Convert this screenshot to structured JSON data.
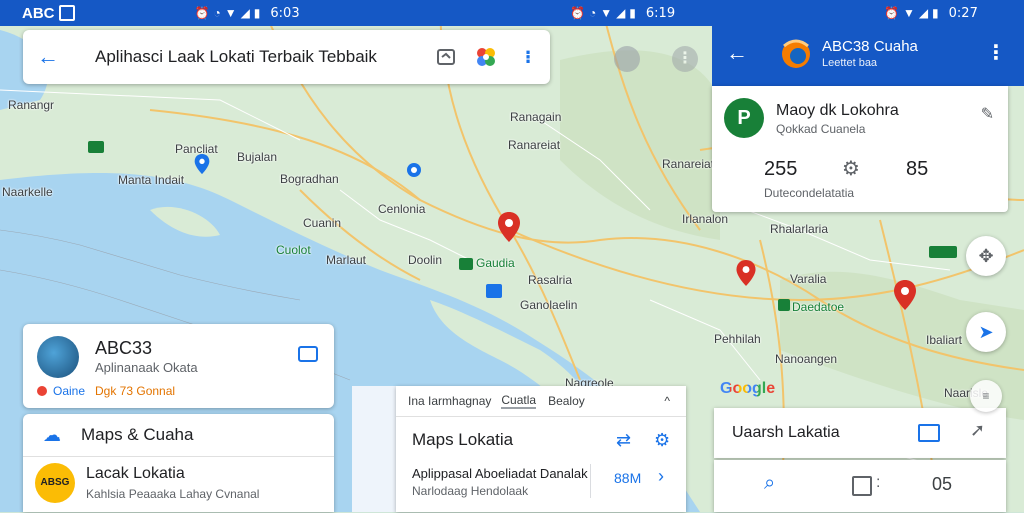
{
  "status_left": {
    "carrier": "ABC",
    "time": "6:03"
  },
  "status_mid": {
    "time": "6:19"
  },
  "status_right": {
    "time": "0:27"
  },
  "search": {
    "title": "Aplihasci Laak Lokati Terbaik Tebbaik"
  },
  "map_labels": [
    {
      "text": "Ranangr"
    },
    {
      "text": "Ranagain"
    },
    {
      "text": "Pancliat"
    },
    {
      "text": "Bujalan"
    },
    {
      "text": "Manta Indait"
    },
    {
      "text": "Bogradhan"
    },
    {
      "text": "Cenlonia"
    },
    {
      "text": "Cuanin"
    },
    {
      "text": "Cuolot"
    },
    {
      "text": "Marlaut"
    },
    {
      "text": "Doolin"
    },
    {
      "text": "Gaudia"
    },
    {
      "text": "Rasalria"
    },
    {
      "text": "Ganolaelin"
    },
    {
      "text": "Ranareiat"
    },
    {
      "text": "Irlanalon"
    },
    {
      "text": "Rhalarlaria"
    },
    {
      "text": "Varalia"
    },
    {
      "text": "Daedatoe"
    },
    {
      "text": "Pehhilah"
    },
    {
      "text": "Nanoangen"
    },
    {
      "text": "Naarisle"
    },
    {
      "text": "Ibaliart"
    },
    {
      "text": "Nagreole"
    },
    {
      "text": "Naarkelle"
    }
  ],
  "place_card": {
    "name": "ABC33",
    "subtitle": "Aplinanaak Okata",
    "badge_a": "Oaine",
    "badge_b": "Dgk 73 Gonnal"
  },
  "list": {
    "item1": "Maps & Cuaha",
    "item2_title": "Lacak Lokatia",
    "item2_sub": "Kahlsia Peaaaka Lahay Cvnanal",
    "item2_logo": "ABSG"
  },
  "bottom_panel": {
    "tabs": [
      "Ina Iarmhagnay",
      "Cuatla",
      "Bealoy"
    ],
    "title": "Maps Lokatia",
    "line1": "Aplippasal Aboeliadat Danalak",
    "line2": "Narlodaag Hendolaak",
    "size": "88M"
  },
  "app_header": {
    "title": "ABC38 Cuaha",
    "subtitle": "Leettet baa"
  },
  "info_card": {
    "title": "Maoy dk Lokohra",
    "subtitle": "Qokkad Cuanela",
    "stat1": "255",
    "stat2": "85",
    "caption": "Dutecondelatatia"
  },
  "right_bottom": {
    "label": "Uaarsh Lakatia",
    "number": "05"
  },
  "google_logo": "Google",
  "colors": {
    "statusbar": "#1558c5",
    "primary": "#1a73e8",
    "pin": "#d93025",
    "green": "#188038",
    "water": "#a8d4f0",
    "land": "#d6ead3"
  }
}
